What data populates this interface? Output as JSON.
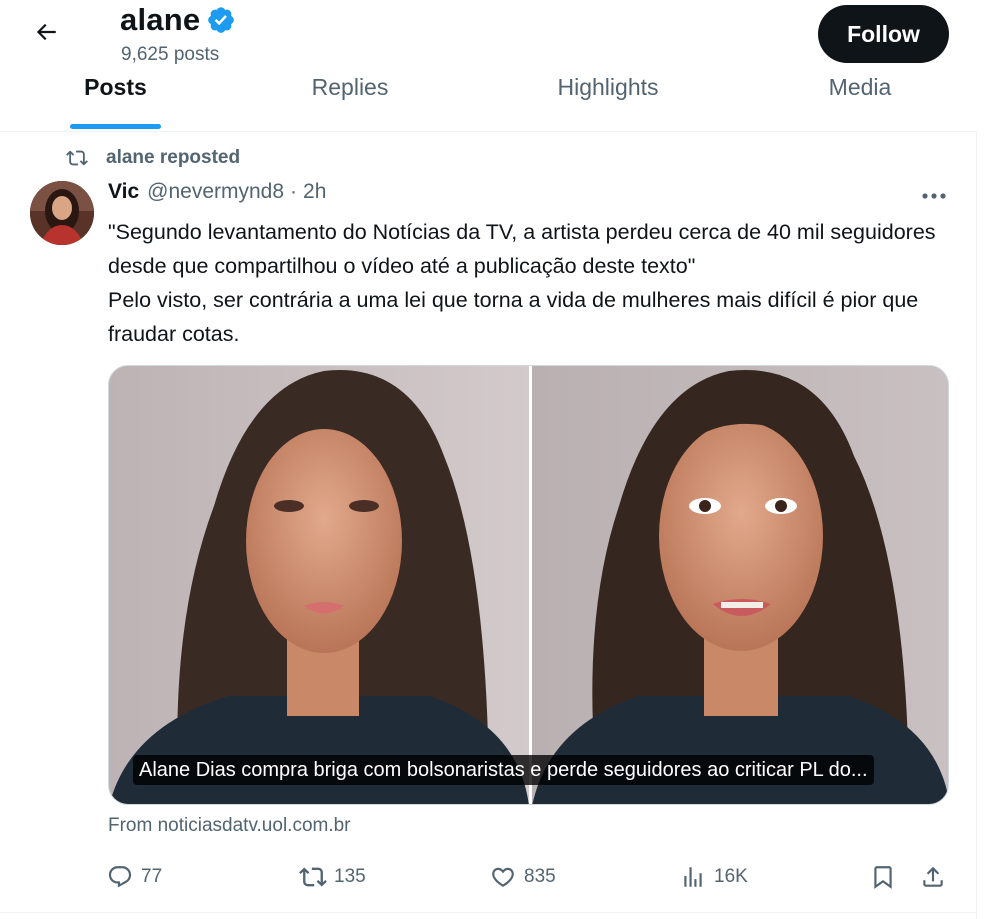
{
  "profile": {
    "name": "alane",
    "post_count": "9,625 posts",
    "follow_label": "Follow"
  },
  "tabs": [
    {
      "label": "Posts",
      "active": true
    },
    {
      "label": "Replies",
      "active": false
    },
    {
      "label": "Highlights",
      "active": false
    },
    {
      "label": "Media",
      "active": false
    }
  ],
  "tweet": {
    "repost_label": "alane reposted",
    "author_name": "Vic",
    "author_handle": "@nevermynd8",
    "separator": "·",
    "time": "2h",
    "text": "\"Segundo levantamento do Notícias da TV, a artista perdeu cerca de 40 mil seguidores desde que compartilhou o vídeo até a publicação deste texto\"\nPelo visto, ser contrária a uma lei que torna a vida de mulheres mais difícil é pior que fraudar cotas.",
    "media_caption": "Alane Dias compra briga com bolsonaristas e perde seguidores ao criticar PL do...",
    "source": "From noticiasdatv.uol.com.br",
    "stats": {
      "replies": "77",
      "reposts": "135",
      "likes": "835",
      "views": "16K"
    }
  },
  "icons": {
    "back": "arrow-left-icon",
    "verified": "verified-badge-icon",
    "repost": "repost-icon",
    "more": "more-horizontal-icon",
    "reply": "reply-icon",
    "like": "heart-icon",
    "views": "analytics-icon",
    "bookmark": "bookmark-icon",
    "share": "share-icon"
  },
  "colors": {
    "accent": "#1d9bf0",
    "text": "#0f1419",
    "secondary": "#536471",
    "follow_bg": "#0f1419"
  }
}
